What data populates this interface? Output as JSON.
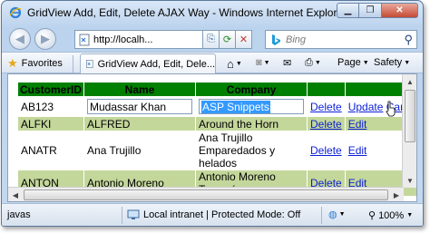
{
  "window": {
    "title": "GridView Add, Edit, Delete AJAX Way - Windows Internet Explorer",
    "minimize_icon": "minimize-icon",
    "restore_icon": "restore-icon",
    "close_icon": "close-icon"
  },
  "nav": {
    "back_icon": "back-arrow-icon",
    "forward_icon": "forward-arrow-icon",
    "address": "http://localh...",
    "search_placeholder": "Bing"
  },
  "favbar": {
    "favorites_label": "Favorites",
    "tab_label": "GridView Add, Edit, Dele...",
    "page_label": "Page",
    "safety_label": "Safety"
  },
  "grid": {
    "headers": [
      "CustomerID",
      "Name",
      "Company",
      "",
      ""
    ],
    "edit_row": {
      "customer_id": "AB123",
      "name_value": "Mudassar Khan",
      "company_value": "ASP Snippets",
      "delete_label": "Delete",
      "update_label": "Update",
      "cancel_label": "Cancel"
    },
    "rows": [
      {
        "customer_id": "ALFKI",
        "name": "ALFRED",
        "company": "Around the Horn",
        "delete_label": "Delete",
        "edit_label": "Edit"
      },
      {
        "customer_id": "ANATR",
        "name": "Ana Trujillo",
        "company_lines": [
          "Ana Trujillo",
          "Emparedados y",
          "helados"
        ],
        "delete_label": "Delete",
        "edit_label": "Edit"
      },
      {
        "customer_id": "ANTON",
        "name": "Antonio Moreno",
        "company_lines": [
          "Antonio Moreno",
          "Taquería"
        ],
        "delete_label": "Delete",
        "edit_label": "Edit"
      }
    ],
    "colors": {
      "header": "#008000",
      "alt_row": "#c4d79b",
      "link": "#0b1fd6"
    }
  },
  "status": {
    "left_text": "javas",
    "zone_text": "Local intranet | Protected Mode: Off",
    "zoom": "100%"
  }
}
